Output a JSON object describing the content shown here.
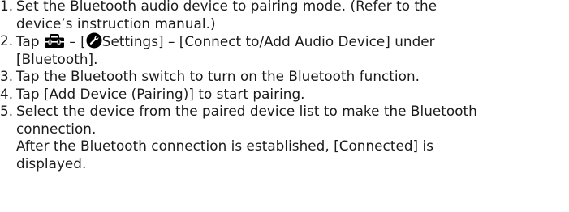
{
  "steps": [
    {
      "number": "1.",
      "lines": [
        "Set the Bluetooth audio device to pairing mode. (Refer to the",
        "device’s instruction manual.)"
      ]
    },
    {
      "number": "2.",
      "text_tap": "Tap",
      "text_dash1": "– [",
      "text_settings": "Settings] – [Connect to/Add Audio Device] under",
      "line2": "[Bluetooth].",
      "icons": [
        "toolbox-icon",
        "settings-icon"
      ]
    },
    {
      "number": "3.",
      "lines": [
        "Tap the Bluetooth switch to turn on the Bluetooth function."
      ]
    },
    {
      "number": "4.",
      "lines": [
        "Tap [Add Device (Pairing)] to start pairing."
      ]
    },
    {
      "number": "5.",
      "lines": [
        "Select the device from the paired device list to make the Bluetooth",
        "connection.",
        "After the Bluetooth connection is established, [Connected] is",
        "displayed."
      ]
    }
  ]
}
